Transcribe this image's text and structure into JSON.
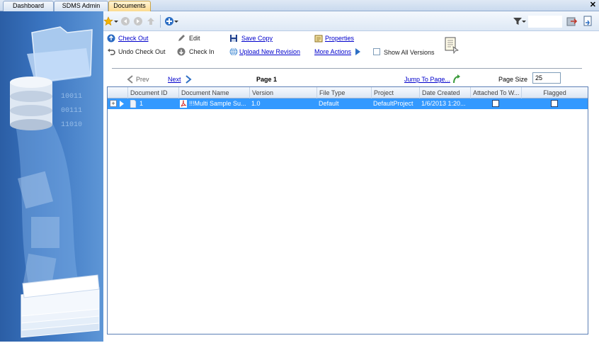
{
  "tabs": [
    {
      "label": "Dashboard",
      "active": false
    },
    {
      "label": "SDMS Admin",
      "active": false
    },
    {
      "label": "Documents",
      "active": true
    }
  ],
  "window": {
    "close_glyph": "✕"
  },
  "toolbar": {
    "icons": [
      "favorites-star-icon",
      "back-icon",
      "forward-icon",
      "up-icon",
      "add-icon",
      "filter-icon",
      "export-icon",
      "import-icon"
    ],
    "filter_value": ""
  },
  "actions": {
    "check_out": "Check Out",
    "undo_check_out": "Undo Check Out",
    "edit": "Edit",
    "check_in": "Check In",
    "save_copy": "Save Copy",
    "upload_new_revision": "Upload New Revision",
    "properties": "Properties",
    "more_actions": "More Actions",
    "show_all_versions": "Show All Versions"
  },
  "pager": {
    "prev": "Prev",
    "next": "Next",
    "page": "Page 1",
    "jump": "Jump To Page...",
    "page_size_label": "Page Size",
    "page_size_value": "25"
  },
  "grid": {
    "columns": [
      "Document ID",
      "Document Name",
      "Version",
      "File Type",
      "Project",
      "Date Created",
      "Attached To W...",
      "Flagged"
    ],
    "rows": [
      {
        "document_id": "1",
        "document_name": "!!!Multi Sample Su...",
        "version": "1.0",
        "file_type": "Default",
        "project": "DefaultProject",
        "date_created": "1/6/2013  1:20...",
        "attached": false,
        "flagged": false
      }
    ]
  },
  "left_panel": {
    "binary_lines": [
      "10011",
      "00111",
      "11010"
    ]
  },
  "colors": {
    "selection": "#3399ff",
    "link": "#0000cc",
    "active_tab": "#fcd98b"
  }
}
